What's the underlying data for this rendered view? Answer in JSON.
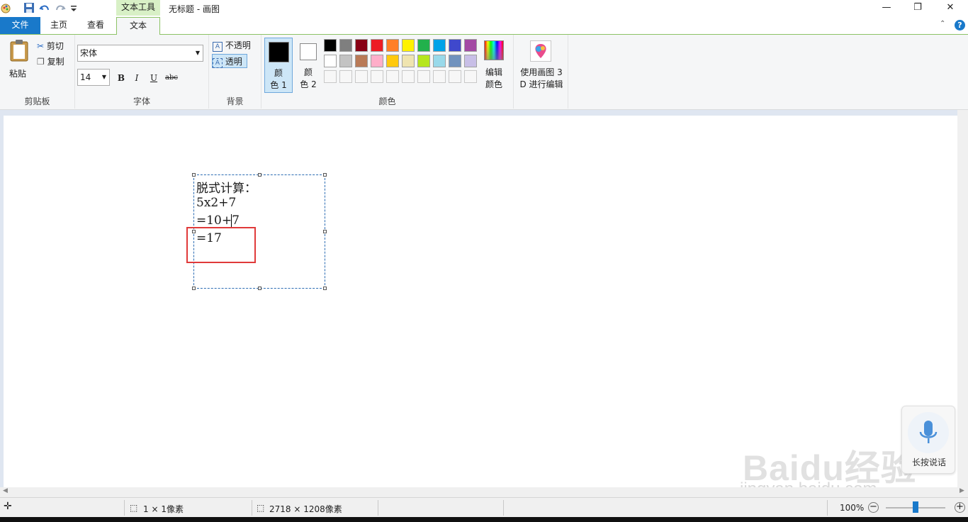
{
  "titlebar": {
    "context_tab": "文本工具",
    "window_title": "无标题 - 画图"
  },
  "tabs": {
    "file": "文件",
    "home": "主页",
    "view": "查看",
    "text": "文本"
  },
  "clipboard": {
    "paste": "粘贴",
    "cut": "剪切",
    "copy": "复制",
    "label": "剪贴板"
  },
  "font": {
    "family": "宋体",
    "size": "14",
    "bold": "B",
    "italic": "I",
    "underline": "U",
    "strike": "abc",
    "label": "字体"
  },
  "background": {
    "opaque": "不透明",
    "transparent": "透明",
    "label": "背景"
  },
  "colors": {
    "color1_line1": "颜",
    "color1_line2": "色 1",
    "color2_line1": "颜",
    "color2_line2": "色 2",
    "edit_line1": "编辑",
    "edit_line2": "颜色",
    "label": "颜色",
    "color1": "#000000",
    "color2": "#ffffff",
    "palette_row1": [
      "#000000",
      "#7f7f7f",
      "#880015",
      "#ed1c24",
      "#ff7f27",
      "#fff200",
      "#22b14c",
      "#00a2e8",
      "#3f48cc",
      "#a349a4"
    ],
    "palette_row2": [
      "#ffffff",
      "#c3c3c3",
      "#b97a57",
      "#ffaec9",
      "#ffc90e",
      "#efe4b0",
      "#b5e61d",
      "#99d9ea",
      "#7092be",
      "#c8bfe7"
    ]
  },
  "paint3d": {
    "line1": "使用画图 3",
    "line2": "D 进行编辑"
  },
  "canvas": {
    "lines": [
      "脱式计算：",
      "5x2+7",
      "=10+7",
      "=17"
    ]
  },
  "voice": {
    "label": "长按说话"
  },
  "watermark": {
    "logo": "Baidu经验",
    "url": "jingyan.baidu.com"
  },
  "status": {
    "selection": "1 × 1像素",
    "image_size": "2718 × 1208像素",
    "zoom": "100%",
    "zoom_level": 0.5
  }
}
